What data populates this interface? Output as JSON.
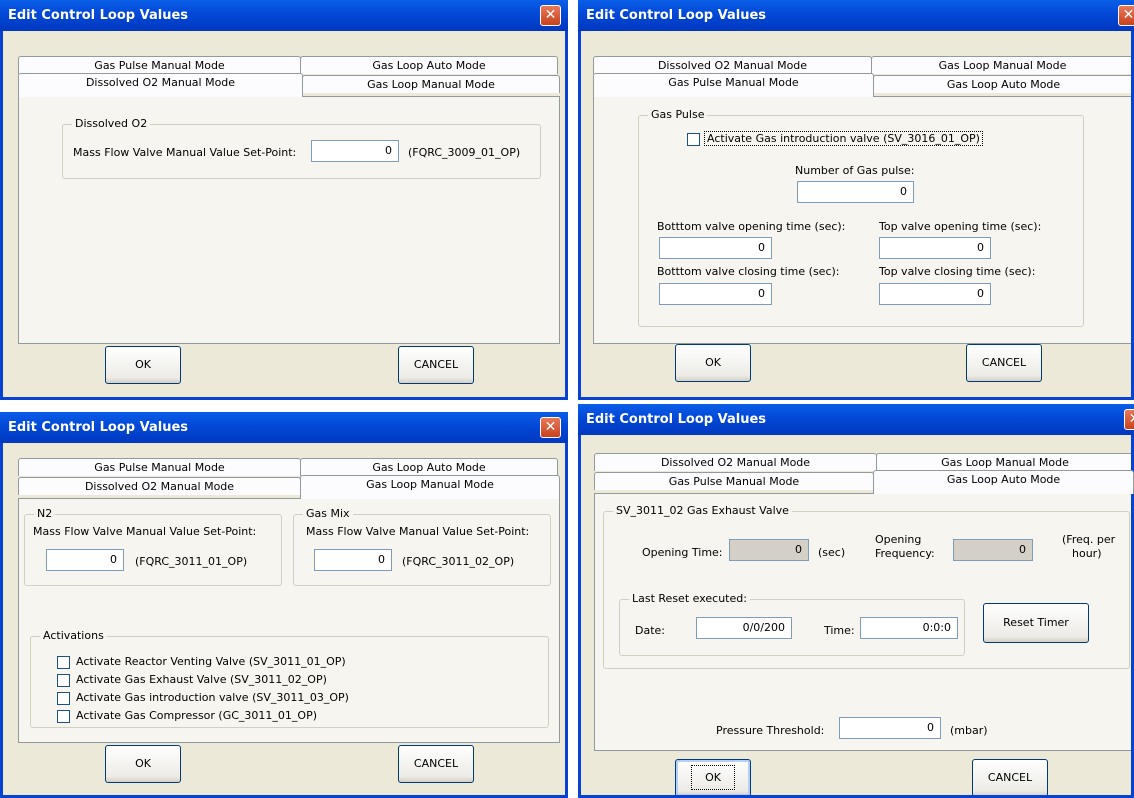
{
  "dialog_title": "Edit Control Loop Values",
  "close_glyph": "✕",
  "tabs": {
    "gas_pulse": "Gas Pulse Manual Mode",
    "gas_loop_auto": "Gas Loop Auto Mode",
    "dissolved_o2": "Dissolved O2 Manual Mode",
    "gas_loop_manual": "Gas Loop Manual Mode"
  },
  "buttons": {
    "ok": "OK",
    "cancel": "CANCEL",
    "reset_timer": "Reset Timer"
  },
  "dialog1": {
    "group_title": "Dissolved O2",
    "mfv_label": "Mass Flow Valve Manual Value Set-Point:",
    "mfv_value": "0",
    "mfv_tag": "(FQRC_3009_01_OP)"
  },
  "dialog2": {
    "group_title": "Gas Pulse",
    "activate_label": "Activate Gas introduction valve (SV_3016_01_OP)",
    "num_pulse_label": "Number of Gas pulse:",
    "num_pulse_value": "0",
    "bottom_open_label": "Botttom valve opening time (sec):",
    "bottom_open_value": "0",
    "top_open_label": "Top valve opening time (sec):",
    "top_open_value": "0",
    "bottom_close_label": "Botttom valve closing time (sec):",
    "bottom_close_value": "0",
    "top_close_label": "Top valve closing time (sec):",
    "top_close_value": "0"
  },
  "dialog3": {
    "n2_title": "N2",
    "n2_label": "Mass Flow Valve Manual Value Set-Point:",
    "n2_value": "0",
    "n2_tag": "(FQRC_3011_01_OP)",
    "mix_title": "Gas Mix",
    "mix_label": "Mass Flow Valve Manual Value Set-Point:",
    "mix_value": "0",
    "mix_tag": "(FQRC_3011_02_OP)",
    "act_title": "Activations",
    "activations": [
      "Activate Reactor Venting Valve (SV_3011_01_OP)",
      "Activate Gas Exhaust Valve (SV_3011_02_OP)",
      "Activate Gas introduction valve (SV_3011_03_OP)",
      "Activate Gas Compressor (GC_3011_01_OP)"
    ]
  },
  "dialog4": {
    "group_title": "SV_3011_02  Gas Exhaust Valve",
    "opening_time_label": "Opening Time:",
    "opening_time_value": "0",
    "opening_time_unit": "(sec)",
    "opening_freq_label1": "Opening",
    "opening_freq_label2": "Frequency:",
    "opening_freq_value": "0",
    "freq_unit1": "(Freq. per",
    "freq_unit2": "hour)",
    "reset_title": "Last Reset executed:",
    "date_label": "Date:",
    "date_value": "0/0/200",
    "time_label": "Time:",
    "time_value": "0:0:0",
    "pressure_label": "Pressure Threshold:",
    "pressure_value": "0",
    "pressure_unit": "(mbar)"
  }
}
